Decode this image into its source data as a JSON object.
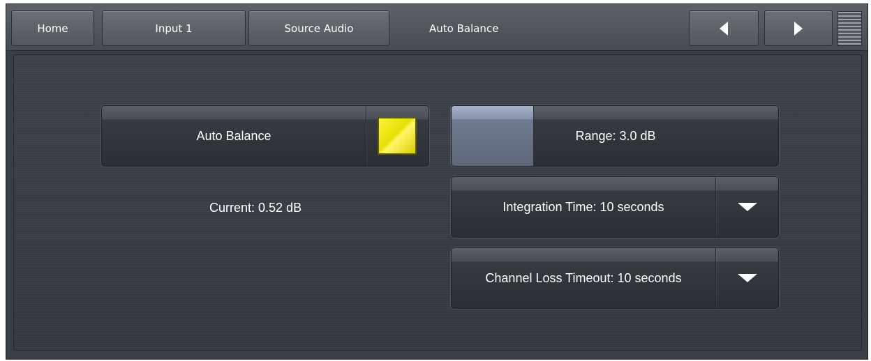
{
  "nav": {
    "home_label": "Home",
    "input_label": "Input 1",
    "source_audio_label": "Source Audio",
    "current_page_label": "Auto Balance",
    "prev_icon": "triangle-left-icon",
    "next_icon": "triangle-right-icon",
    "menu_icon": "menu-lines-icon"
  },
  "auto_balance": {
    "label": "Auto Balance",
    "indicator_color": "#f2e600",
    "enabled": true
  },
  "current": {
    "text": "Current: 0.52 dB"
  },
  "range": {
    "label": "Range: 3.0 dB",
    "slider_fraction": 0.25
  },
  "integration_time": {
    "label": "Integration Time: 10 seconds",
    "dropdown_icon": "chevron-down-icon"
  },
  "channel_loss_timeout": {
    "label": "Channel Loss Timeout: 10 seconds",
    "dropdown_icon": "chevron-down-icon"
  }
}
